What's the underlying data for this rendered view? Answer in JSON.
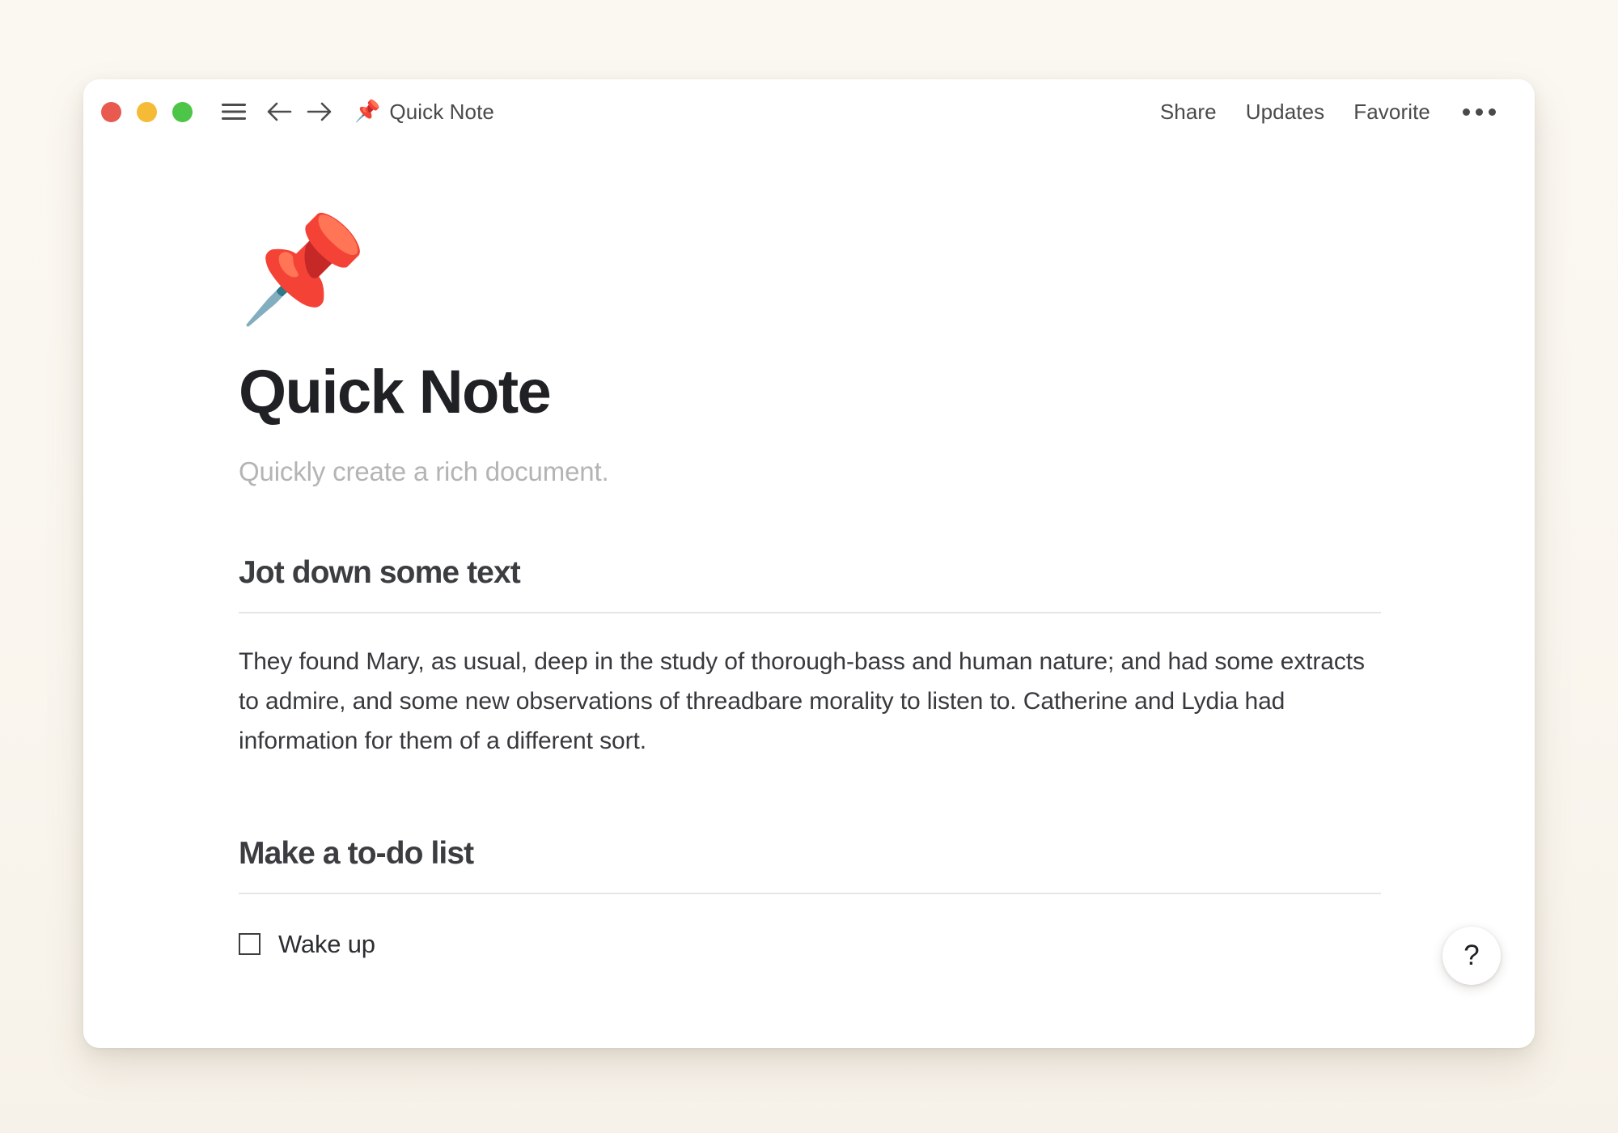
{
  "window": {
    "title": "Quick Note",
    "title_icon": "pushpin-emoji",
    "title_emoji": "📌"
  },
  "titlebar": {
    "traffic_lights": [
      {
        "name": "close",
        "color": "#e8594f"
      },
      {
        "name": "minimize",
        "color": "#f5bb36"
      },
      {
        "name": "maximize",
        "color": "#4cc548"
      }
    ],
    "menu_icon": "hamburger-menu-icon",
    "back_icon": "arrow-left-icon",
    "forward_icon": "arrow-right-icon",
    "actions": [
      {
        "label": "Share",
        "name": "share-button"
      },
      {
        "label": "Updates",
        "name": "updates-button"
      },
      {
        "label": "Favorite",
        "name": "favorite-button"
      }
    ],
    "more_icon": "ellipsis-icon"
  },
  "document": {
    "cover_emoji": "📌",
    "cover_emoji_name": "pushpin-emoji",
    "title": "Quick Note",
    "subtitle": "Quickly create a rich document.",
    "sections": [
      {
        "heading": "Jot down some text",
        "paragraph": "They found Mary, as usual, deep in the study of thorough-bass and human nature; and had some extracts to admire, and some new observations of threadbare morality to listen to. Catherine and Lydia had information for them of a different sort."
      },
      {
        "heading": "Make a to-do list",
        "todos": [
          {
            "label": "Wake up",
            "checked": false
          }
        ]
      }
    ]
  },
  "help": {
    "label": "?",
    "icon": "question-mark-icon"
  },
  "colors": {
    "desktop_background": "#faf6ef",
    "window_background": "#ffffff",
    "title_text": "#1f2124",
    "subtitle_text": "#b4b4b4",
    "body_text": "#37393c",
    "rule": "#e6e6e6"
  }
}
